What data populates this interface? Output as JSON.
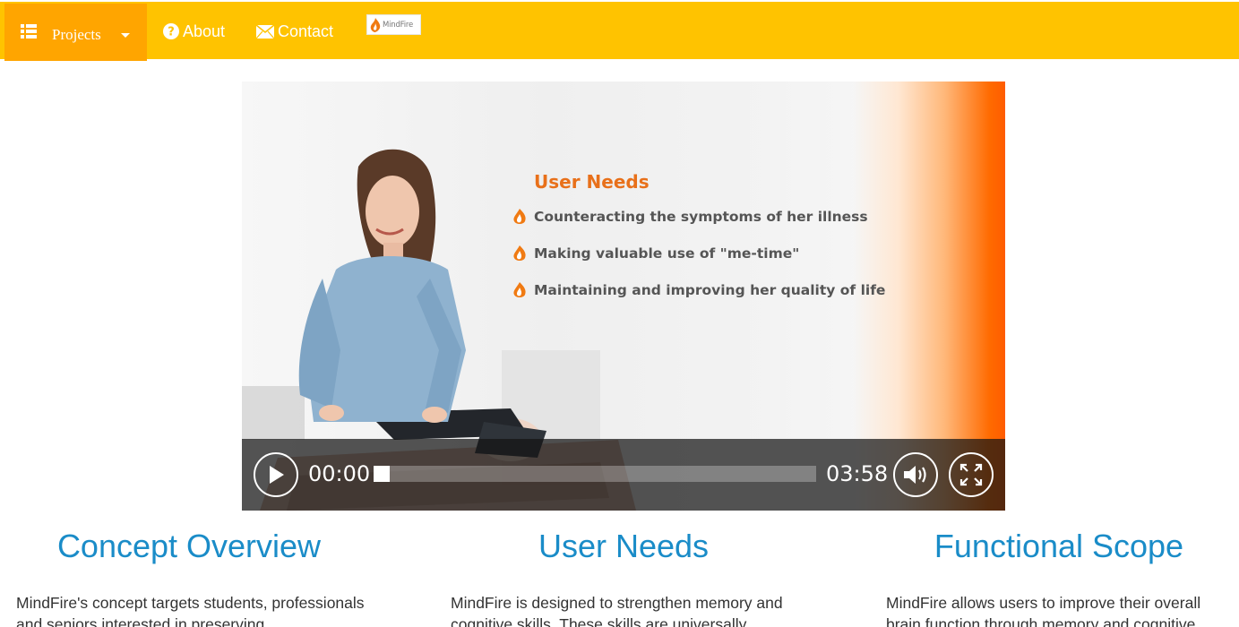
{
  "navbar": {
    "projects_label": "Projects",
    "about_label": "About",
    "contact_label": "Contact",
    "logo_text": "MindFire",
    "colors": {
      "bar": "#ffc300",
      "active": "#ffa500"
    }
  },
  "video": {
    "slide": {
      "title": "User Needs",
      "items": [
        "Counteracting the symptoms of her illness",
        "Making valuable use of \"me-time\"",
        "Maintaining and improving her quality of life"
      ]
    },
    "current_time": "00:00",
    "total_time": "03:58",
    "progress": 0,
    "icons": [
      "play-icon",
      "volume-icon",
      "fullscreen-icon"
    ]
  },
  "columns": [
    {
      "heading": "Concept Overview",
      "text": "MindFire's concept targets students, professionals and seniors interested in preserving"
    },
    {
      "heading": "User Needs",
      "text": "MindFire is designed to strengthen memory and cognitive skills. These skills are universally"
    },
    {
      "heading": "Functional Scope",
      "text": "MindFire allows users to improve their overall brain function through memory and cognitive"
    }
  ],
  "accent_heading_color": "#1a8cc8"
}
